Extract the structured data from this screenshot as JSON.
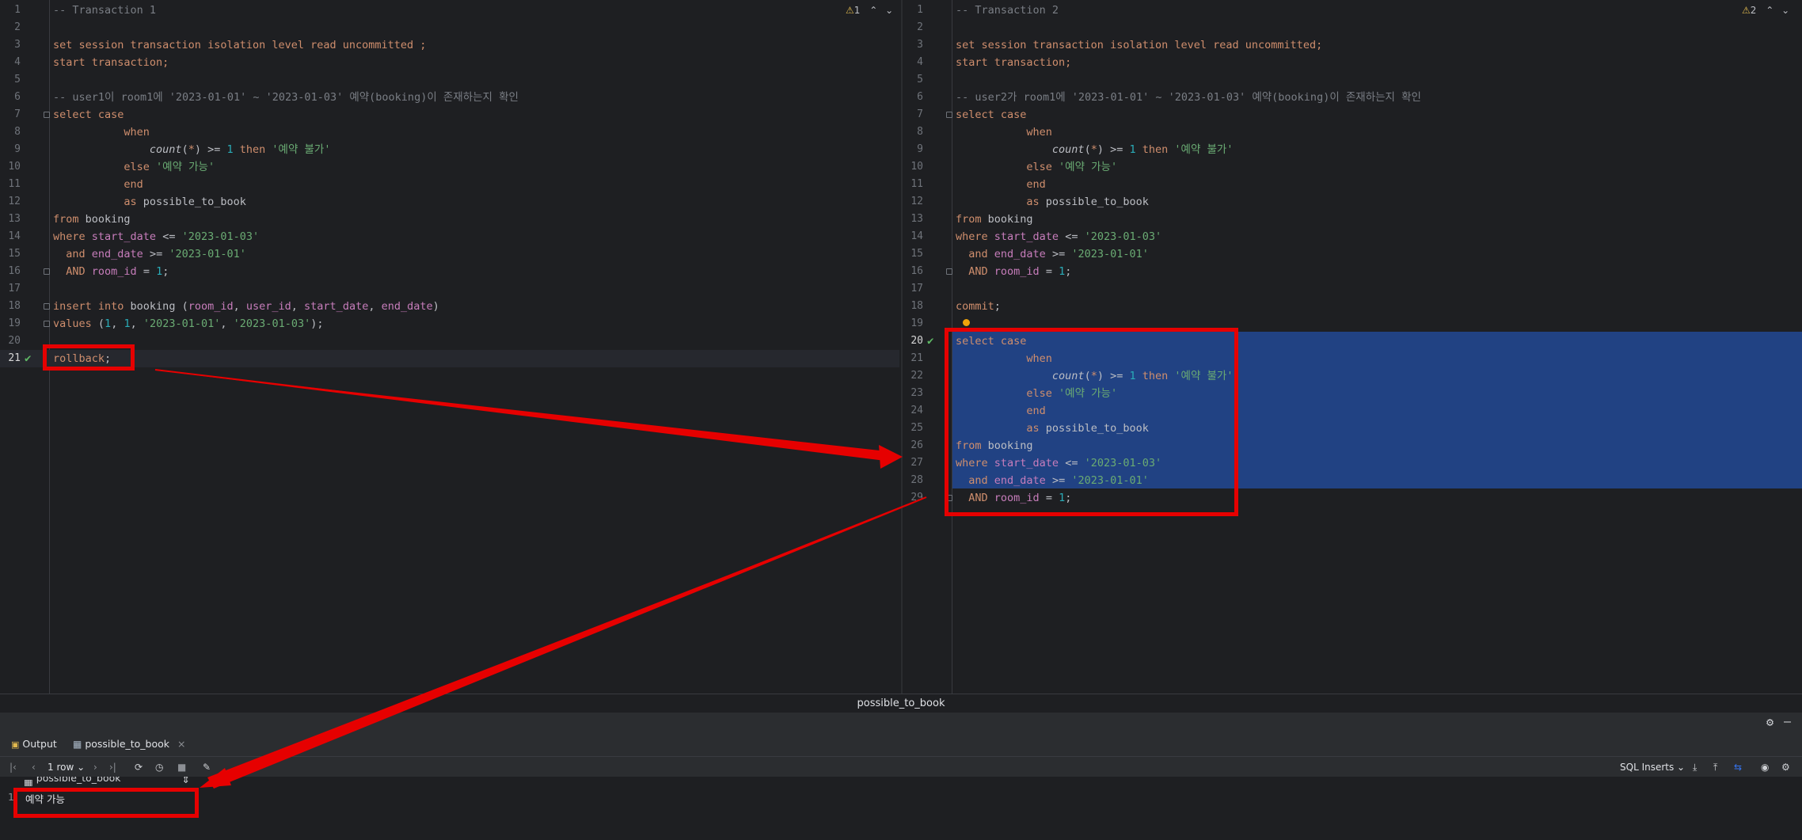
{
  "left_editor": {
    "warning_count": "1",
    "lines": [
      {
        "n": "1",
        "segs": [
          [
            "cmt",
            "-- Transaction 1"
          ]
        ]
      },
      {
        "n": "2",
        "segs": []
      },
      {
        "n": "3",
        "segs": [
          [
            "kw",
            "set session transaction isolation level read uncommitted ;"
          ]
        ]
      },
      {
        "n": "4",
        "segs": [
          [
            "kw",
            "start transaction;"
          ]
        ]
      },
      {
        "n": "5",
        "segs": []
      },
      {
        "n": "6",
        "segs": [
          [
            "cmt",
            "-- user1이 room1에 '2023-01-01' ~ '2023-01-03' 예약(booking)이 존재하는지 확인"
          ]
        ]
      },
      {
        "n": "7",
        "segs": [
          [
            "kw",
            "select "
          ],
          [
            "kw",
            "case"
          ]
        ]
      },
      {
        "n": "8",
        "segs": [
          [
            "kw",
            "           when"
          ]
        ]
      },
      {
        "n": "9",
        "segs": [
          [
            "plain",
            "               "
          ],
          [
            "fn",
            "count"
          ],
          [
            "plain",
            "("
          ],
          [
            "kw",
            "*"
          ],
          [
            "plain",
            ") >= "
          ],
          [
            "num",
            "1"
          ],
          [
            "kw",
            " then "
          ],
          [
            "str",
            "'예약 불가'"
          ]
        ]
      },
      {
        "n": "10",
        "segs": [
          [
            "kw",
            "           else "
          ],
          [
            "str",
            "'예약 가능'"
          ]
        ]
      },
      {
        "n": "11",
        "segs": [
          [
            "kw",
            "           end"
          ]
        ]
      },
      {
        "n": "12",
        "segs": [
          [
            "kw",
            "           as "
          ],
          [
            "plain",
            "possible_to_book"
          ]
        ]
      },
      {
        "n": "13",
        "segs": [
          [
            "kw",
            "from "
          ],
          [
            "plain",
            "booking"
          ]
        ]
      },
      {
        "n": "14",
        "segs": [
          [
            "kw",
            "where "
          ],
          [
            "col",
            "start_date"
          ],
          [
            "plain",
            " <= "
          ],
          [
            "str",
            "'2023-01-03'"
          ]
        ]
      },
      {
        "n": "15",
        "segs": [
          [
            "kw",
            "  and "
          ],
          [
            "col",
            "end_date"
          ],
          [
            "plain",
            " >= "
          ],
          [
            "str",
            "'2023-01-01'"
          ]
        ]
      },
      {
        "n": "16",
        "segs": [
          [
            "kw",
            "  AND "
          ],
          [
            "col",
            "room_id"
          ],
          [
            "plain",
            " = "
          ],
          [
            "num",
            "1"
          ],
          [
            "plain",
            ";"
          ]
        ]
      },
      {
        "n": "17",
        "segs": []
      },
      {
        "n": "18",
        "segs": [
          [
            "kw",
            "insert into "
          ],
          [
            "plain",
            "booking ("
          ],
          [
            "col",
            "room_id"
          ],
          [
            "plain",
            ", "
          ],
          [
            "col",
            "user_id"
          ],
          [
            "plain",
            ", "
          ],
          [
            "col",
            "start_date"
          ],
          [
            "plain",
            ", "
          ],
          [
            "col",
            "end_date"
          ],
          [
            "plain",
            ")"
          ]
        ]
      },
      {
        "n": "19",
        "segs": [
          [
            "kw",
            "values "
          ],
          [
            "plain",
            "("
          ],
          [
            "num",
            "1"
          ],
          [
            "plain",
            ", "
          ],
          [
            "num",
            "1"
          ],
          [
            "plain",
            ", "
          ],
          [
            "str",
            "'2023-01-01'"
          ],
          [
            "plain",
            ", "
          ],
          [
            "str",
            "'2023-01-03'"
          ],
          [
            "plain",
            ");"
          ]
        ]
      },
      {
        "n": "20",
        "segs": []
      },
      {
        "n": "21",
        "segs": [
          [
            "kw",
            "rollback"
          ],
          [
            "plain",
            ";"
          ]
        ]
      }
    ]
  },
  "right_editor": {
    "warning_count": "2",
    "lines": [
      {
        "n": "1",
        "segs": [
          [
            "cmt",
            "-- Transaction 2"
          ]
        ]
      },
      {
        "n": "2",
        "segs": []
      },
      {
        "n": "3",
        "segs": [
          [
            "kw",
            "set session transaction isolation level read uncommitted;"
          ]
        ]
      },
      {
        "n": "4",
        "segs": [
          [
            "kw",
            "start transaction;"
          ]
        ]
      },
      {
        "n": "5",
        "segs": []
      },
      {
        "n": "6",
        "segs": [
          [
            "cmt",
            "-- user2가 room1에 '2023-01-01' ~ '2023-01-03' 예약(booking)이 존재하는지 확인"
          ]
        ]
      },
      {
        "n": "7",
        "segs": [
          [
            "kw",
            "select "
          ],
          [
            "kw",
            "case"
          ]
        ]
      },
      {
        "n": "8",
        "segs": [
          [
            "kw",
            "           when"
          ]
        ]
      },
      {
        "n": "9",
        "segs": [
          [
            "plain",
            "               "
          ],
          [
            "fn",
            "count"
          ],
          [
            "plain",
            "("
          ],
          [
            "kw",
            "*"
          ],
          [
            "plain",
            ") >= "
          ],
          [
            "num",
            "1"
          ],
          [
            "kw",
            " then "
          ],
          [
            "str",
            "'예약 불가'"
          ]
        ]
      },
      {
        "n": "10",
        "segs": [
          [
            "kw",
            "           else "
          ],
          [
            "str",
            "'예약 가능'"
          ]
        ]
      },
      {
        "n": "11",
        "segs": [
          [
            "kw",
            "           end"
          ]
        ]
      },
      {
        "n": "12",
        "segs": [
          [
            "kw",
            "           as "
          ],
          [
            "plain",
            "possible_to_book"
          ]
        ]
      },
      {
        "n": "13",
        "segs": [
          [
            "kw",
            "from "
          ],
          [
            "plain",
            "booking"
          ]
        ]
      },
      {
        "n": "14",
        "segs": [
          [
            "kw",
            "where "
          ],
          [
            "col",
            "start_date"
          ],
          [
            "plain",
            " <= "
          ],
          [
            "str",
            "'2023-01-03'"
          ]
        ]
      },
      {
        "n": "15",
        "segs": [
          [
            "kw",
            "  and "
          ],
          [
            "col",
            "end_date"
          ],
          [
            "plain",
            " >= "
          ],
          [
            "str",
            "'2023-01-01'"
          ]
        ]
      },
      {
        "n": "16",
        "segs": [
          [
            "kw",
            "  AND "
          ],
          [
            "col",
            "room_id"
          ],
          [
            "plain",
            " = "
          ],
          [
            "num",
            "1"
          ],
          [
            "plain",
            ";"
          ]
        ]
      },
      {
        "n": "17",
        "segs": []
      },
      {
        "n": "18",
        "segs": [
          [
            "kw",
            "commit"
          ],
          [
            "plain",
            ";"
          ]
        ]
      },
      {
        "n": "19",
        "segs": []
      },
      {
        "n": "20",
        "segs": [
          [
            "kw",
            "select "
          ],
          [
            "kw",
            "case"
          ]
        ]
      },
      {
        "n": "21",
        "segs": [
          [
            "kw",
            "           when"
          ]
        ]
      },
      {
        "n": "22",
        "segs": [
          [
            "plain",
            "               "
          ],
          [
            "fn",
            "count"
          ],
          [
            "plain",
            "("
          ],
          [
            "kw",
            "*"
          ],
          [
            "plain",
            ") >= "
          ],
          [
            "num",
            "1"
          ],
          [
            "kw",
            " then "
          ],
          [
            "str",
            "'예약 불가'"
          ]
        ]
      },
      {
        "n": "23",
        "segs": [
          [
            "kw",
            "           else "
          ],
          [
            "str",
            "'예약 가능'"
          ]
        ]
      },
      {
        "n": "24",
        "segs": [
          [
            "kw",
            "           end"
          ]
        ]
      },
      {
        "n": "25",
        "segs": [
          [
            "kw",
            "           as "
          ],
          [
            "plain",
            "possible_to_book"
          ]
        ]
      },
      {
        "n": "26",
        "segs": [
          [
            "kw",
            "from "
          ],
          [
            "plain",
            "booking"
          ]
        ]
      },
      {
        "n": "27",
        "segs": [
          [
            "kw",
            "where "
          ],
          [
            "col",
            "start_date"
          ],
          [
            "plain",
            " <= "
          ],
          [
            "str",
            "'2023-01-03'"
          ]
        ]
      },
      {
        "n": "28",
        "segs": [
          [
            "kw",
            "  and "
          ],
          [
            "col",
            "end_date"
          ],
          [
            "plain",
            " >= "
          ],
          [
            "str",
            "'2023-01-01'"
          ]
        ]
      },
      {
        "n": "29",
        "segs": [
          [
            "kw",
            "  AND "
          ],
          [
            "col",
            "room_id"
          ],
          [
            "plain",
            " = "
          ],
          [
            "num",
            "1"
          ],
          [
            "plain",
            ";"
          ]
        ]
      }
    ]
  },
  "result_title": "possible_to_book",
  "tabs": {
    "output": "Output",
    "result": "possible_to_book"
  },
  "toolbar": {
    "rows": "1 row",
    "export_format": "SQL Inserts"
  },
  "grid": {
    "column": "possible_to_book",
    "row_number": "1",
    "cell_value": "예약 가능"
  },
  "colors": {
    "selection": "#214283",
    "annotation": "#e60000",
    "keyword": "#cf8e6d",
    "string": "#6aab73"
  }
}
